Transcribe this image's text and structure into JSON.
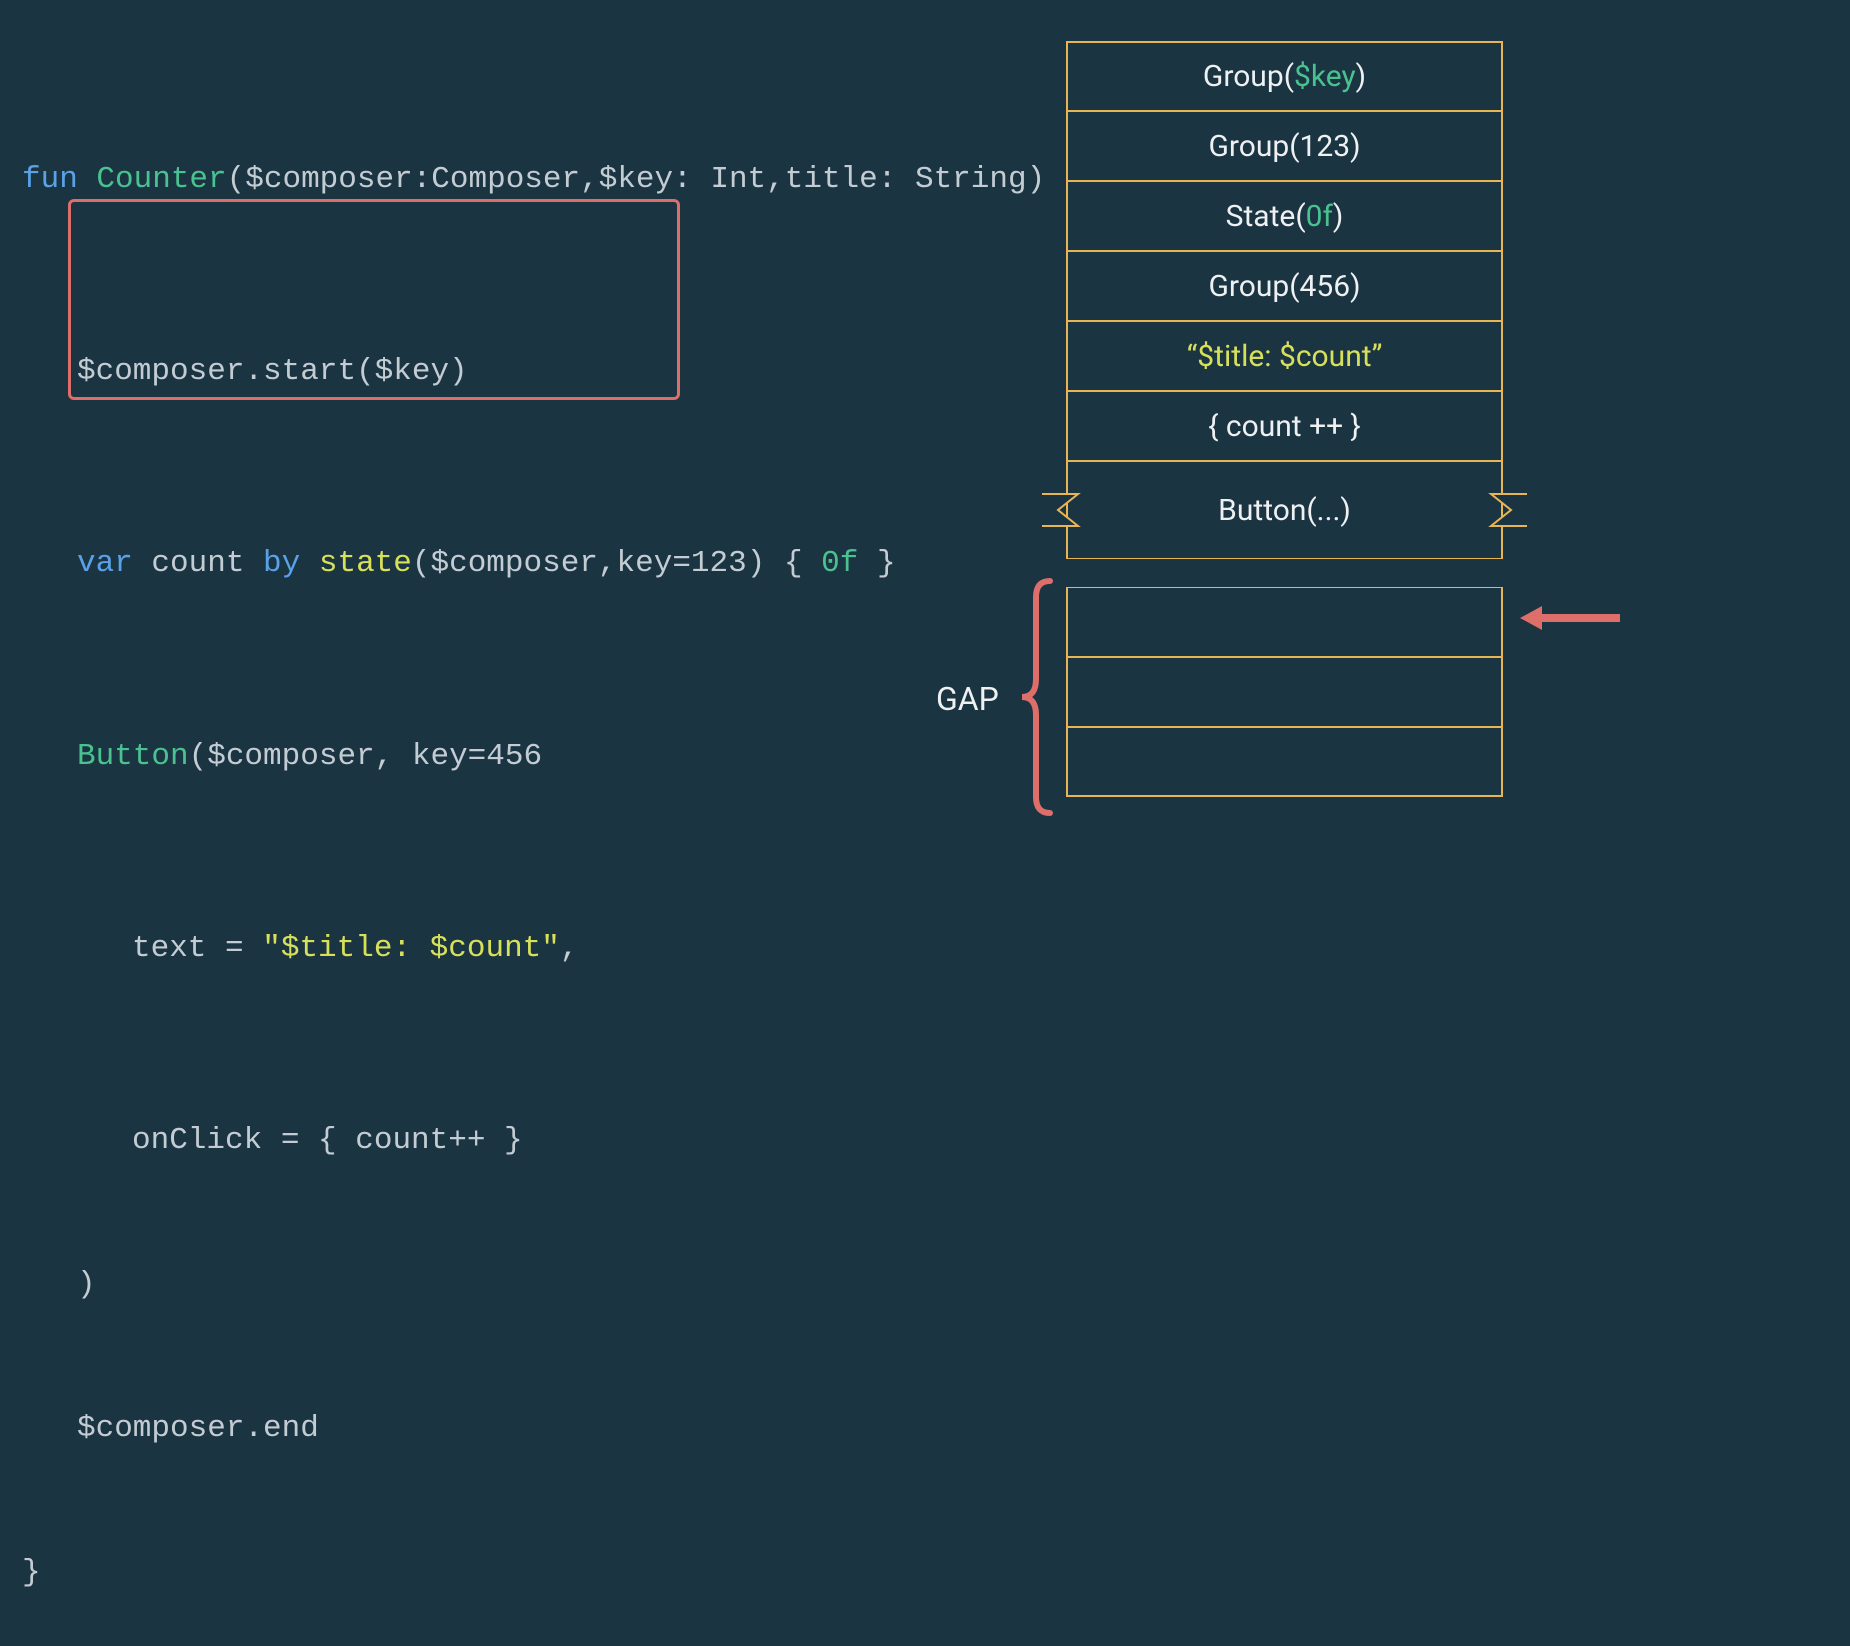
{
  "code": {
    "l1": {
      "fun": "fun",
      "name": "Counter",
      "rest1": "($composer:Composer,$key: Int,title: String) {"
    },
    "l2": "$composer.start($key)",
    "l3": {
      "var": "var",
      "mid": " count ",
      "by": "by",
      "sp": " ",
      "state": "state",
      "args": "($composer,key=123)",
      "brace": " { ",
      "zero": "0f",
      "close": " }"
    },
    "l4": {
      "button": "Button",
      "rest": "($composer, key=456"
    },
    "l5": {
      "pre": "text = ",
      "str": "\"$title: $count\"",
      "post": ","
    },
    "l6": "onClick = { count++ }",
    "l7": ")",
    "l8": "$composer.end",
    "l9": "}"
  },
  "table": {
    "row1": {
      "pre": "Group(",
      "var": "$key",
      "post": ")"
    },
    "row2": "Group(123)",
    "row3": {
      "pre": "State(",
      "val": "0f",
      "post": ")"
    },
    "row4": "Group(456)",
    "row5": "“$title: $count”",
    "row6": "{ count ++ }",
    "row7": "Button(...)"
  },
  "gapLabel": "GAP",
  "colors": {
    "background": "#1a3442",
    "accentOrange": "#e9b554",
    "accentRed": "#dd6e6a",
    "green": "#4ac28f",
    "yellow": "#d6e05a",
    "blue": "#5aa1e6"
  }
}
